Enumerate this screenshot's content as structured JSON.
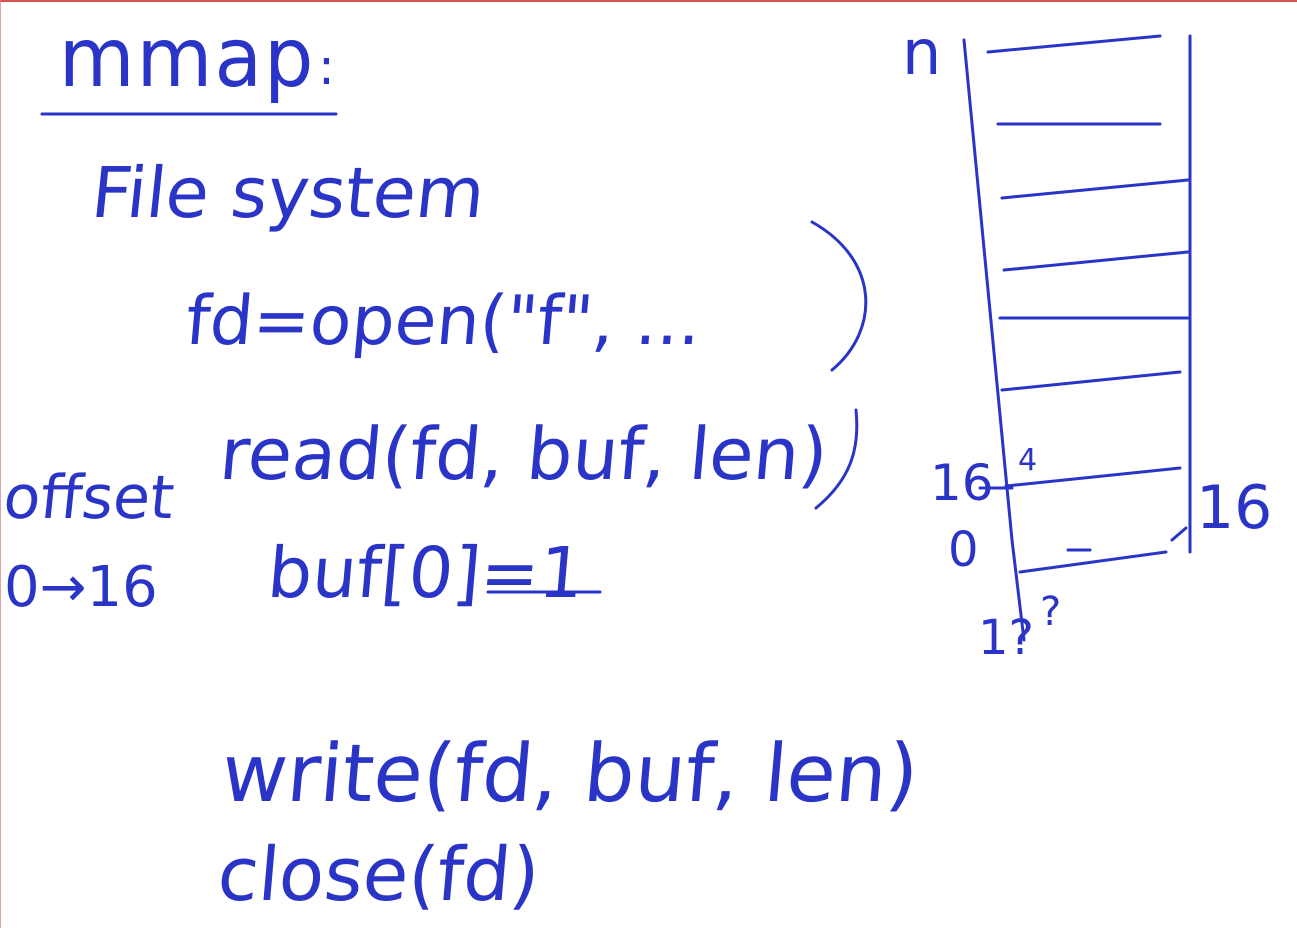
{
  "note": {
    "title": "mmap",
    "title_colon": ":",
    "subtitle": "File system",
    "code_lines": [
      "fd=open(\"f\", ...",
      "read(fd, buf, len)",
      "buf[0]=1",
      "write(fd, buf, len)",
      "close(fd)"
    ],
    "left_labels": [
      "offset",
      "0→16"
    ],
    "diagram_labels": {
      "top": "n",
      "left_16": "16",
      "right_16": "16",
      "left_0": "0",
      "bottom_1": "1?",
      "question": "?",
      "small_mark": "4"
    },
    "ink_color": "#2a35c8"
  }
}
